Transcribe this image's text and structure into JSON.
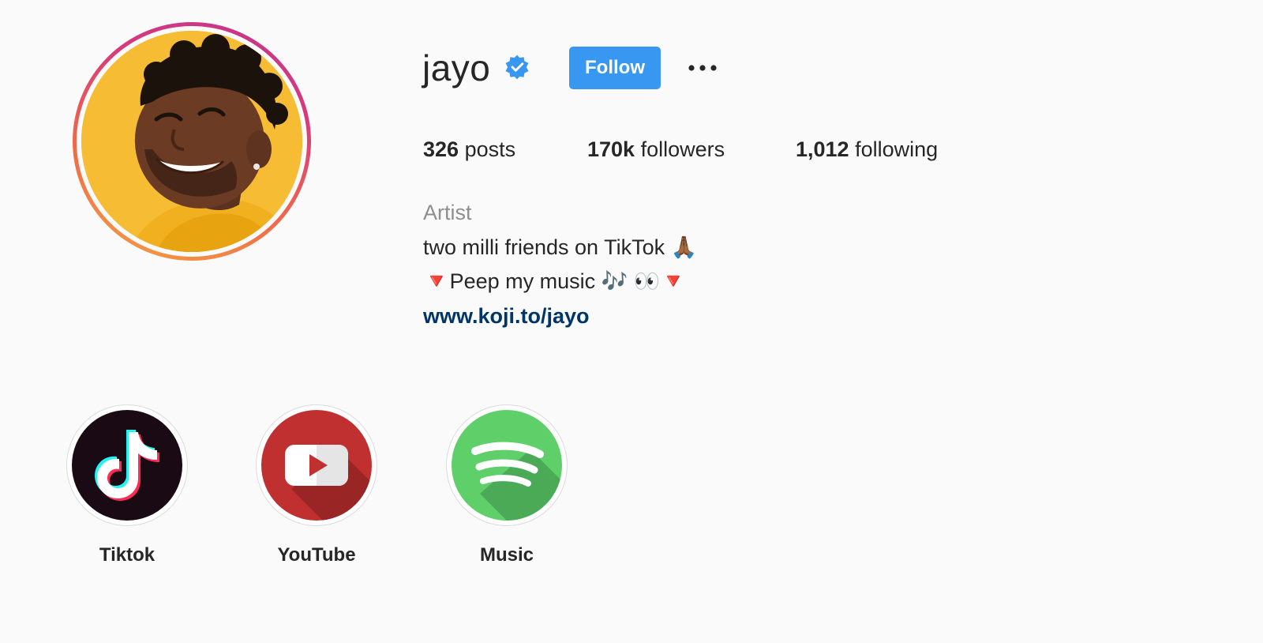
{
  "profile": {
    "username": "jayo",
    "verified": true,
    "verified_icon": "verified-badge-icon",
    "follow_label": "Follow",
    "more_icon": "more-options-icon",
    "accent_color": "#3897f0",
    "link_color": "#003569"
  },
  "stats": {
    "posts_count": "326",
    "posts_label": "posts",
    "followers_count": "170k",
    "followers_label": "followers",
    "following_count": "1,012",
    "following_label": "following"
  },
  "bio": {
    "category": "Artist",
    "line1": "two milli friends on TikTok 🙏🏾",
    "line2": "🔻Peep my music 🎶 👀🔻",
    "link": "www.koji.to/jayo"
  },
  "highlights": [
    {
      "label": "Tiktok",
      "icon": "tiktok-icon"
    },
    {
      "label": "YouTube",
      "icon": "youtube-icon"
    },
    {
      "label": "Music",
      "icon": "spotify-icon"
    }
  ]
}
